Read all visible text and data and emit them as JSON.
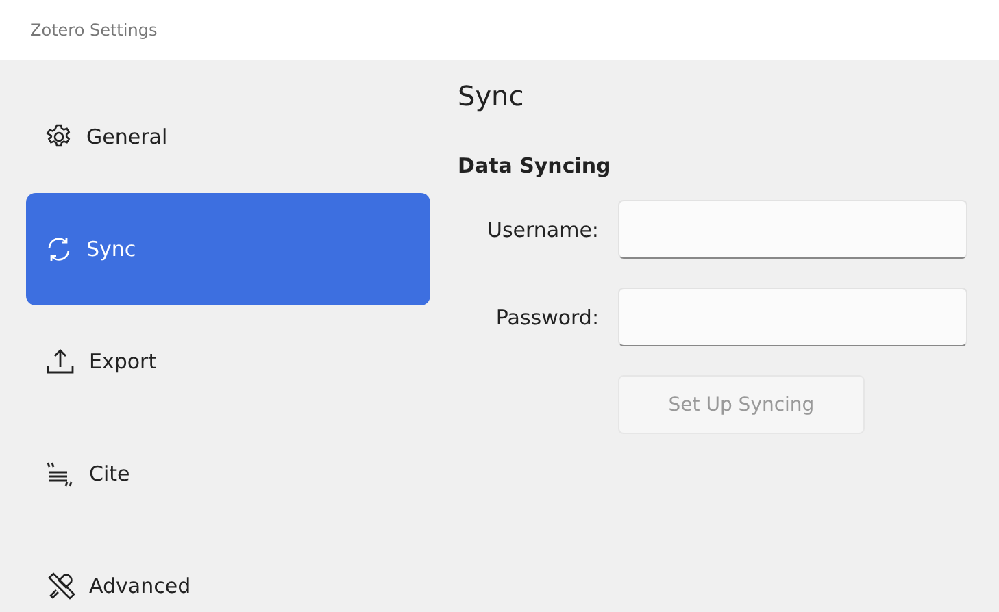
{
  "window": {
    "title": "Zotero Settings"
  },
  "sidebar": {
    "items": [
      {
        "label": "General",
        "kind": "gear",
        "selected": false
      },
      {
        "label": "Sync",
        "kind": "sync",
        "selected": true
      },
      {
        "label": "Export",
        "kind": "export",
        "selected": false
      },
      {
        "label": "Cite",
        "kind": "cite",
        "selected": false
      },
      {
        "label": "Advanced",
        "kind": "tools",
        "selected": false
      }
    ]
  },
  "content": {
    "title": "Sync",
    "section": "Data Syncing",
    "fields": [
      {
        "label": "Username:"
      },
      {
        "label": "Password:"
      }
    ],
    "button": {
      "label": "Set Up Syncing",
      "disabled": true
    }
  }
}
